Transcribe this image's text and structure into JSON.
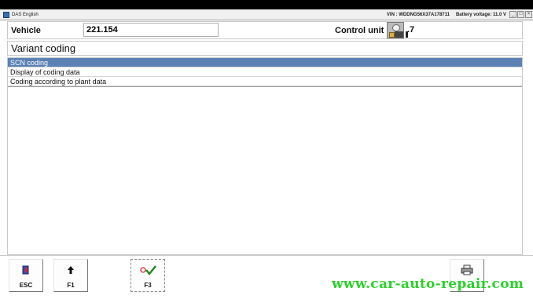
{
  "window": {
    "title": "DAS English",
    "vin": "VIN : WDDNG56X37A178711",
    "battery": "Battery voltage: 11.0 V",
    "controls": [
      "_",
      "□",
      "×"
    ]
  },
  "header": {
    "vehicle_label": "Vehicle",
    "vehicle_value": "221.154",
    "control_unit_label": "Control unit",
    "control_unit_value": ".7"
  },
  "section": {
    "title": "Variant coding"
  },
  "list": {
    "items": [
      "SCN coding",
      "Display of coding data",
      "Coding according to plant data"
    ],
    "selected_index": 0,
    "selected_color": "#5b81b5"
  },
  "toolbar": {
    "buttons": [
      {
        "label": "ESC",
        "icon": "exit-door-icon"
      },
      {
        "label": "F1",
        "icon": "arrow-up-icon"
      },
      {
        "label": "F3",
        "icon": "check-confirm-icon"
      },
      {
        "label": "",
        "icon": "printer-icon"
      }
    ]
  },
  "watermark": {
    "text": "www.car-auto-repair.com",
    "color": "#2bd12b"
  }
}
